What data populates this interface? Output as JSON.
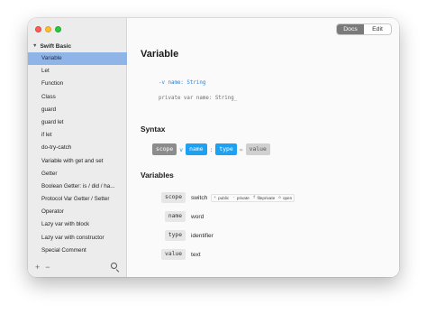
{
  "sidebar": {
    "section_label": "Swift Basic",
    "items": [
      {
        "label": "Variable",
        "active": true
      },
      {
        "label": "Let"
      },
      {
        "label": "Function"
      },
      {
        "label": "Class"
      },
      {
        "label": "guard"
      },
      {
        "label": "guard let"
      },
      {
        "label": "if let"
      },
      {
        "label": "do-try-catch"
      },
      {
        "label": "Variable with get and set"
      },
      {
        "label": "Getter"
      },
      {
        "label": "Boolean Getter: is / did / ha..."
      },
      {
        "label": "Protocol Var Getter / Setter"
      },
      {
        "label": "Operator"
      },
      {
        "label": "Lazy var with block"
      },
      {
        "label": "Lazy var with constructor"
      },
      {
        "label": "Special Comment"
      }
    ],
    "add_label": "+",
    "remove_label": "−"
  },
  "toolbar": {
    "docs_label": "Docs",
    "edit_label": "Edit"
  },
  "main": {
    "title": "Variable",
    "code_line1": "-v name: String",
    "code_line2": "private var name: String_",
    "syntax_heading": "Syntax",
    "syntax": {
      "scope": "scope",
      "sep1": "v",
      "name": "name",
      "sep2": ":",
      "type": "type",
      "sep3": "=",
      "value": "value"
    },
    "variables_heading": "Variables",
    "variables": [
      {
        "key": "scope",
        "desc": "switch",
        "options": [
          {
            "k": "+",
            "v": "public"
          },
          {
            "k": "-",
            "v": "private"
          },
          {
            "k": "f",
            "v": "fileprivate"
          },
          {
            "k": "o",
            "v": "open"
          }
        ]
      },
      {
        "key": "name",
        "desc": "word"
      },
      {
        "key": "type",
        "desc": "identifier"
      },
      {
        "key": "value",
        "desc": "text"
      }
    ]
  },
  "colors": {
    "selection": "#8fb4e8",
    "accent_blue": "#1da1f2",
    "token_grey": "#8c8c8c",
    "code_blue": "#2a7fd4"
  }
}
